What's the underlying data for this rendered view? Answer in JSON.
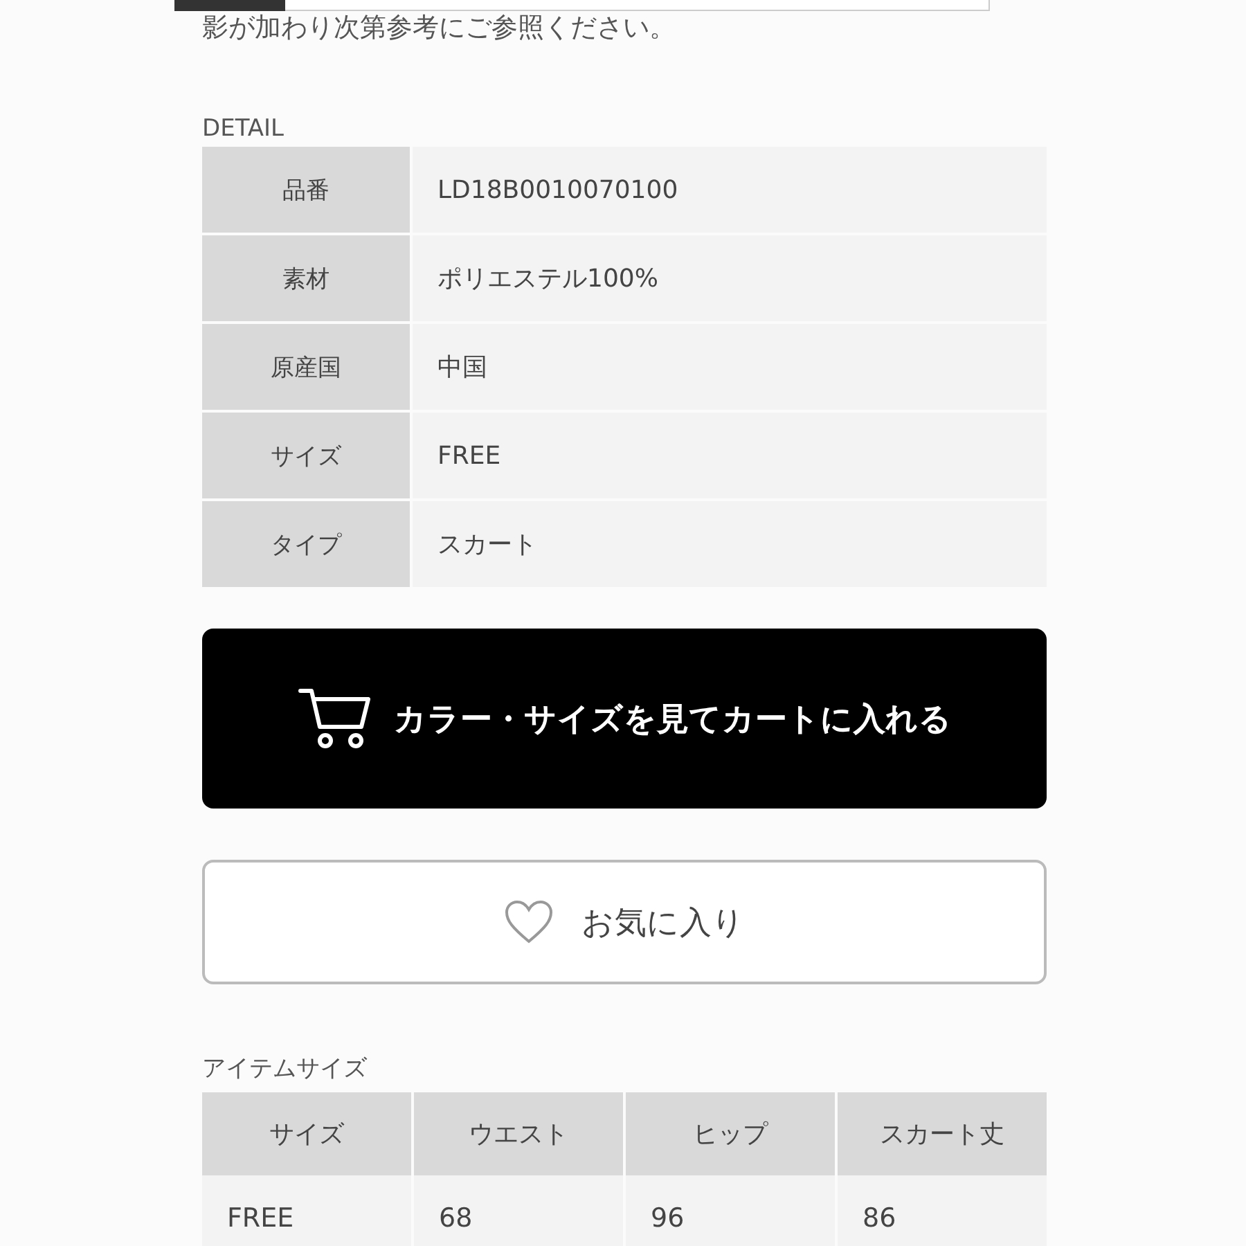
{
  "notice": "影が加わり次第参考にご参照ください。",
  "detail": {
    "title": "DETAIL",
    "rows": [
      {
        "label": "品番",
        "value": "LD18B0010070100"
      },
      {
        "label": "素材",
        "value": "ポリエステル100%"
      },
      {
        "label": "原産国",
        "value": "中国"
      },
      {
        "label": "サイズ",
        "value": "FREE"
      },
      {
        "label": "タイプ",
        "value": "スカート"
      }
    ]
  },
  "cart_button": {
    "label": "カラー・サイズを見てカートに入れる"
  },
  "favorite_button": {
    "label": "お気に入り"
  },
  "item_size": {
    "title": "アイテムサイズ",
    "columns": [
      "サイズ",
      "ウエスト",
      "ヒップ",
      "スカート丈"
    ],
    "rows": [
      [
        "FREE",
        "68",
        "96",
        "86"
      ]
    ]
  }
}
